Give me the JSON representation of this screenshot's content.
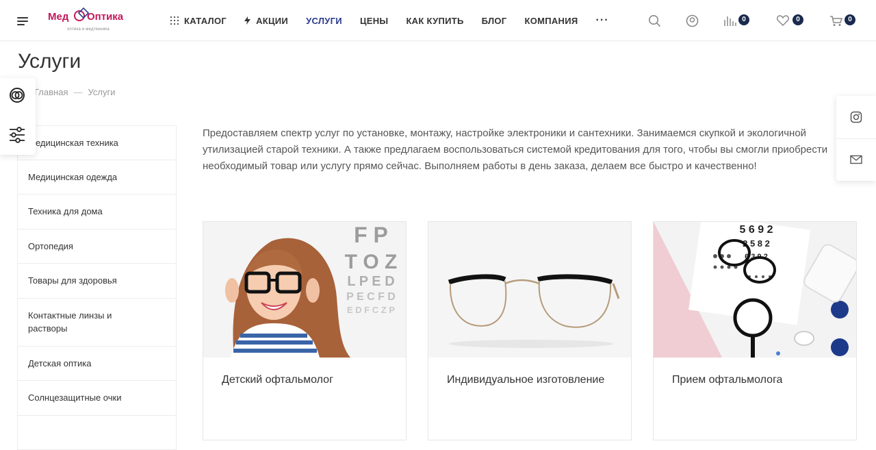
{
  "header": {
    "logo": {
      "part1": "Мед",
      "part2": "Оптика",
      "tagline": "оптика и медтехника"
    },
    "nav": [
      {
        "label": "КАТАЛОГ",
        "icon": "grid-dots-icon"
      },
      {
        "label": "АКЦИИ",
        "icon": "lightning-icon"
      },
      {
        "label": "УСЛУГИ",
        "active": true
      },
      {
        "label": "ЦЕНЫ"
      },
      {
        "label": "КАК КУПИТЬ"
      },
      {
        "label": "БЛОГ"
      },
      {
        "label": "КОМПАНИЯ"
      },
      {
        "label": "···"
      }
    ],
    "compare_count": "0",
    "favorites_count": "0",
    "cart_count": "0",
    "accent_color": "#2b3a8c",
    "brand_color": "#c2185b"
  },
  "page": {
    "title": "Услуги",
    "breadcrumbs": {
      "home": "Главная",
      "separator": "—",
      "current": "Услуги"
    }
  },
  "sidebar": {
    "items": [
      "Медицинская техника",
      "Медицинская одежда",
      "Техника для дома",
      "Ортопедия",
      "Товары для здоровья",
      "Контактные линзы и растворы",
      "Детская оптика",
      "Солнцезащитные очки"
    ]
  },
  "intro_text": "Предоставляем спектр услуг по установке, монтажу, настройке электроники и сантехники. Занимаемся скупкой и экологичной утилизацией старой техники. А также предлагаем воспользоваться системой кредитования для того, чтобы вы смогли приобрести необходимый товар или услугу прямо сейчас. Выполняем работы в день заказа, делаем все быстро и качественно!",
  "cards": [
    {
      "title": "Детский офтальмолог"
    },
    {
      "title": "Индивидуальное изготовление"
    },
    {
      "title": "Прием офтальмолога"
    }
  ],
  "eye_chart": {
    "row1": "F P",
    "row2": "T O Z",
    "row3": "L P E D",
    "row4": "P E C F D",
    "row5": "E D F C Z P"
  },
  "eye_chart2": {
    "row1": "5 6 9 2",
    "row2": "2 5 8 2",
    "row3": "6 3 9 2"
  }
}
